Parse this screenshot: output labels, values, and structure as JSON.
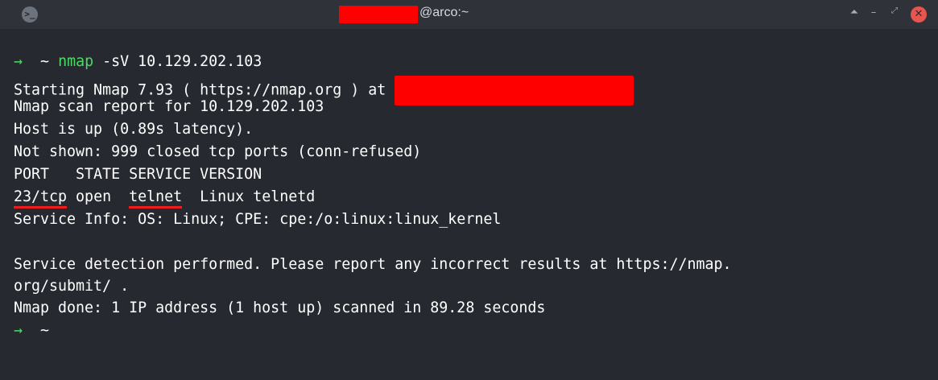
{
  "window": {
    "title_host": "@arco:~",
    "icons": {
      "app": "terminal-icon",
      "shade": "shade-icon",
      "minimize": "minimize-icon",
      "maximize": "maximize-icon",
      "close": "close-icon"
    },
    "controls": {
      "shade_glyph": "⏶",
      "minimize_glyph": "–",
      "maximize_glyph": "⤢",
      "close_glyph": "✕",
      "app_glyph": ">_"
    }
  },
  "terminal": {
    "prompt_arrow": "→",
    "prompt_tilde": "~",
    "command_name": "nmap",
    "command_args": " -sV 10.129.202.103",
    "starting_line": "Starting Nmap 7.93 ( https://nmap.org ) at ",
    "report_line": "Nmap scan report for 10.129.202.103",
    "host_line": "Host is up (0.89s latency).",
    "not_shown_line": "Not shown: 999 closed tcp ports (conn-refused)",
    "header_line": "PORT   STATE SERVICE VERSION",
    "port_row": {
      "port": "23/tcp",
      "state_gap": " open  ",
      "service": "telnet",
      "version": "  Linux telnetd"
    },
    "service_info_line": "Service Info: OS: Linux; CPE: cpe:/o:linux:linux_kernel",
    "detection_line_1": "Service detection performed. Please report any incorrect results at https://nmap.",
    "detection_line_2": "org/submit/ .",
    "done_line": "Nmap done: 1 IP address (1 host up) scanned in 89.28 seconds",
    "final_prompt_arrow": "→",
    "final_prompt_tilde": "~"
  },
  "colors": {
    "prompt_green": "#4cd964",
    "redaction": "#ff0000",
    "underline": "#ee1d1d",
    "background": "#262a30"
  }
}
